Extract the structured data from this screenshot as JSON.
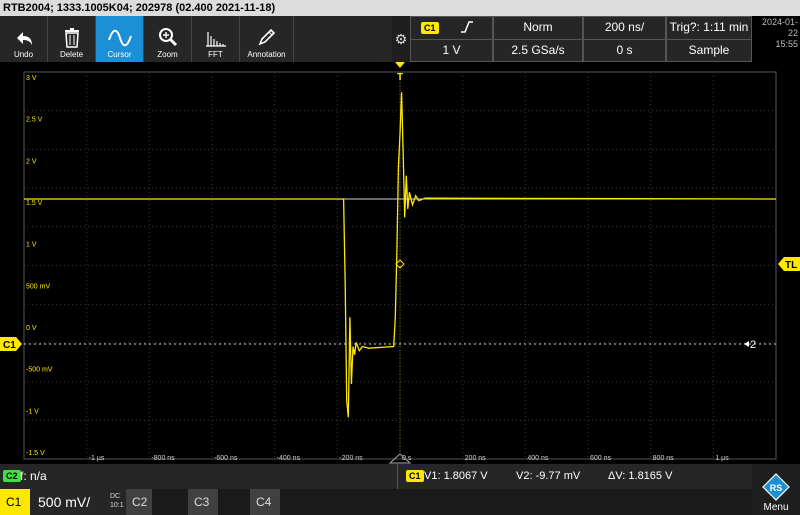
{
  "title": "RTB2004; 1333.1005K04; 202978 (02.400 2021-11-18)",
  "toolbar": {
    "undo": "Undo",
    "delete": "Delete",
    "cursor": "Cursor",
    "zoom": "Zoom",
    "fft": "FFT",
    "annotation": "Annotation"
  },
  "header": {
    "channel": "C1",
    "scale": "1 V",
    "trigger_edge": "rising-edge-icon",
    "mode": "Norm",
    "sample_rate": "2.5 GSa/s",
    "timebase": "200 ns/",
    "position": "0 s",
    "trig": "Trig?: 1:11 min",
    "acq": "Sample",
    "date": "2024-01-22",
    "time": "15:55"
  },
  "grid": {
    "y_labels": [
      "3 V",
      "2.5 V",
      "2 V",
      "1.5 V",
      "1 V",
      "500 mV",
      "0 V",
      "-500 mV",
      "-1 V",
      "-1.5 V"
    ],
    "x_labels": [
      "-1 µs",
      "-800 ns",
      "-600 ns",
      "-400 ns",
      "-200 ns",
      "0 s",
      "200 ns",
      "400 ns",
      "600 ns",
      "800 ns",
      "1 µs"
    ]
  },
  "markers": {
    "channel": "C1",
    "trigger_level": "TL",
    "cursor_label": "2",
    "trigger_pos": "T"
  },
  "status": {
    "f_channel": "C2",
    "f_text": "f: n/a",
    "cursor_channel": "C1",
    "v1": "V1: 1.8067 V",
    "v2": "V2: -9.77 mV",
    "dv": "ΔV: 1.8165 V"
  },
  "channels": {
    "c1_label": "C1",
    "c1_scale": "500 mV/",
    "c1_coupling": "DC",
    "c1_probe": "10:1",
    "c2_label": "C2",
    "c3_label": "C3",
    "c4_label": "C4"
  },
  "menu": "Menu",
  "chart_data": {
    "type": "line",
    "xlabel": "",
    "ylabel": "",
    "x_unit": "ns",
    "y_unit": "V",
    "xlim": [
      -1200,
      1200
    ],
    "ylim": [
      -1.5,
      3.0
    ],
    "grid": true,
    "series": [
      {
        "color": "#ffe800",
        "x": [
          -1200,
          -180,
          -175,
          -170,
          -165,
          -160,
          -155,
          -150,
          -145,
          -140,
          -130,
          -120,
          -100,
          -20,
          -15,
          -10,
          -5,
          0,
          5,
          10,
          15,
          20,
          25,
          30,
          40,
          50,
          60,
          80,
          1200
        ],
        "y": [
          1.62,
          1.62,
          0.6,
          -0.8,
          -1.0,
          0.2,
          -0.6,
          -0.15,
          -0.25,
          -0.1,
          -0.2,
          -0.15,
          -0.17,
          -0.15,
          0.2,
          1.0,
          2.0,
          2.4,
          2.9,
          2.2,
          1.4,
          1.9,
          1.5,
          1.7,
          1.55,
          1.66,
          1.6,
          1.63,
          1.62
        ]
      }
    ]
  }
}
